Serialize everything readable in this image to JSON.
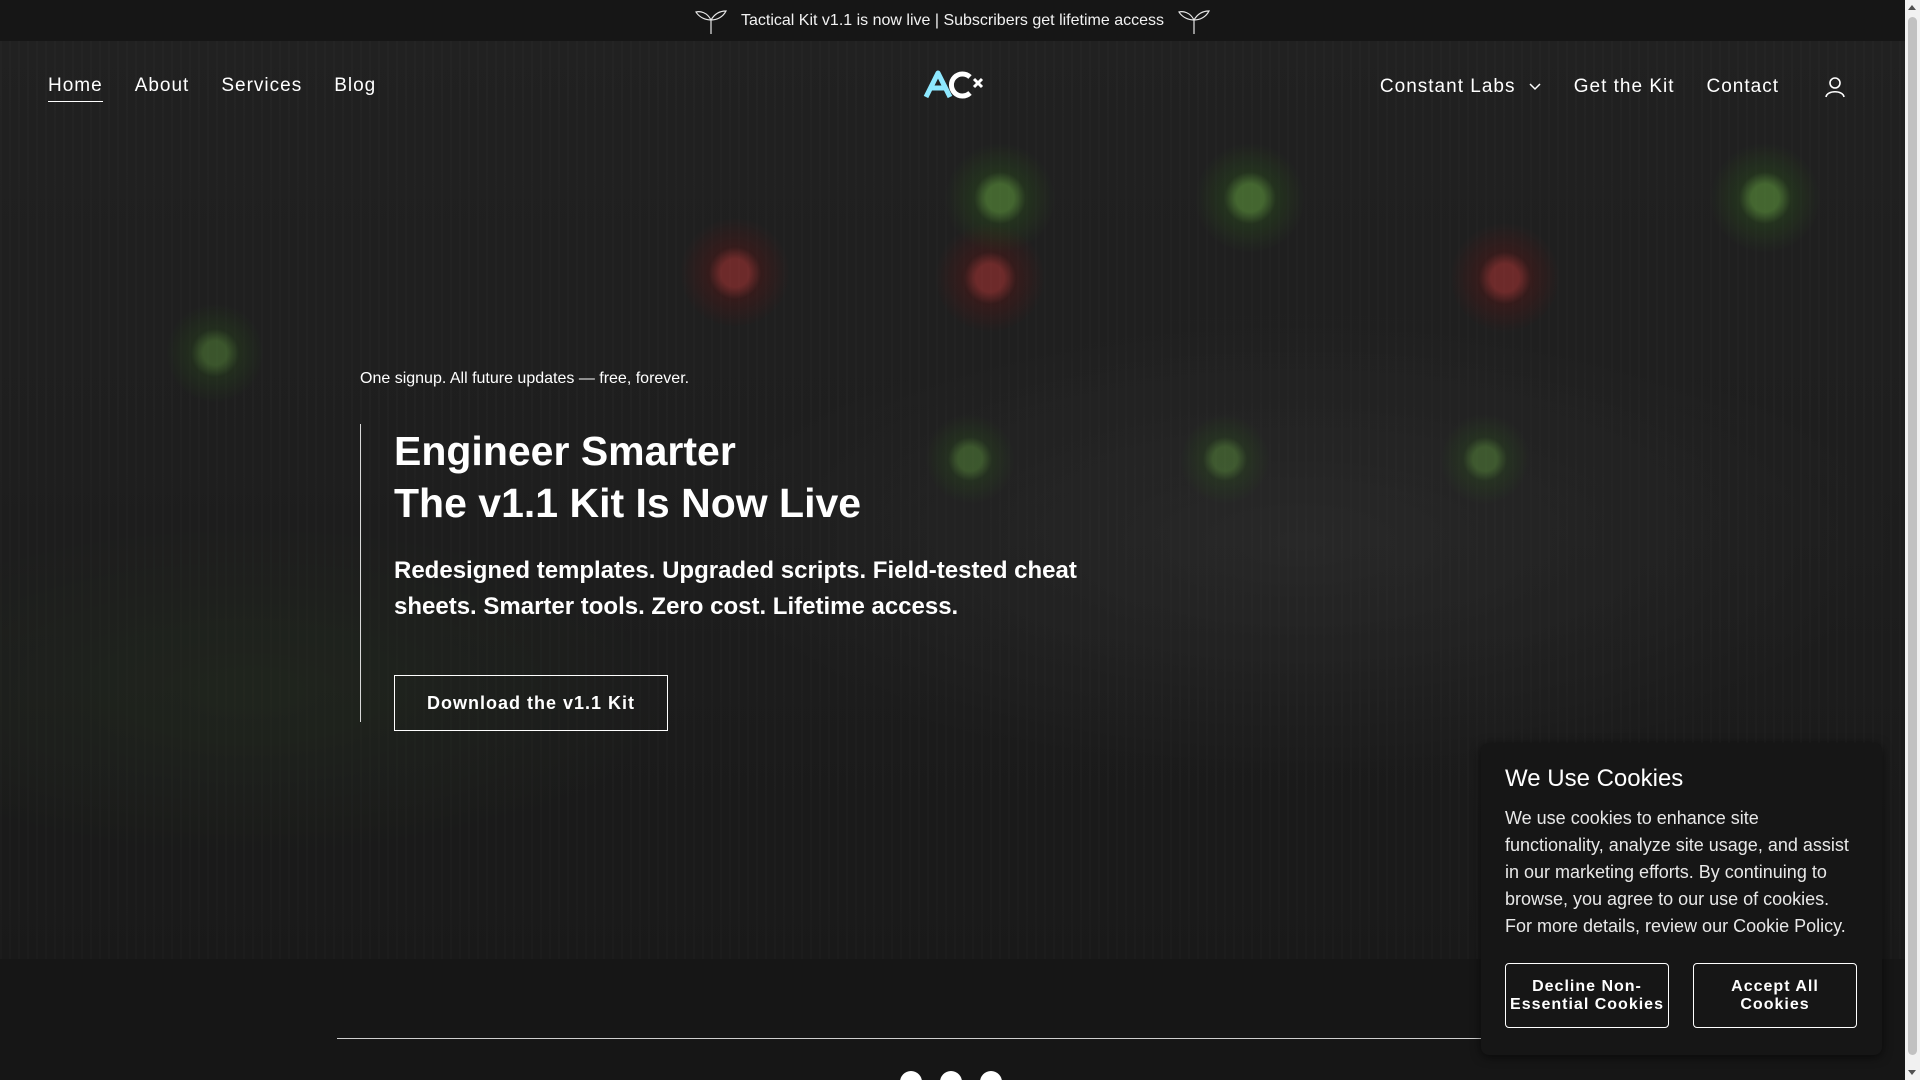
{
  "announcement": {
    "text": "Tactical Kit v1.1 is now live | Subscribers get lifetime access",
    "left_icon": "sprout-icon",
    "right_icon": "sprout-icon"
  },
  "nav": {
    "left": [
      {
        "label": "Home",
        "active": true
      },
      {
        "label": "About"
      },
      {
        "label": "Services"
      },
      {
        "label": "Blog"
      }
    ],
    "logo_icon": "ac-logo-icon",
    "right": [
      {
        "label": "Constant Labs",
        "dropdown": true
      },
      {
        "label": "Get the Kit"
      },
      {
        "label": "Contact"
      }
    ],
    "account_icon": "user-icon"
  },
  "hero": {
    "tagline": "One signup. All future updates — free, forever.",
    "title_line1": "Engineer Smarter",
    "title_line2": "The v1.1 Kit Is Now Live",
    "subtitle": "Redesigned templates. Upgraded scripts. Field-tested cheat sheets. Smarter tools. Zero cost. Lifetime access.",
    "cta_label": "Download the v1.1 Kit"
  },
  "cookie_banner": {
    "title": "We Use Cookies",
    "body": "We use cookies to enhance site functionality, analyze site usage, and assist in our marketing efforts. By continuing to browse, you agree to our use of cookies. For more details, review our Cookie Policy.",
    "decline_label": "Decline Non-Essential Cookies",
    "accept_label": "Accept All Cookies"
  },
  "footer": {
    "social_icons": [
      "facebook-icon",
      "linkedin-icon",
      "email-icon"
    ]
  },
  "colors": {
    "background": "#161616",
    "text": "#ffffff"
  }
}
